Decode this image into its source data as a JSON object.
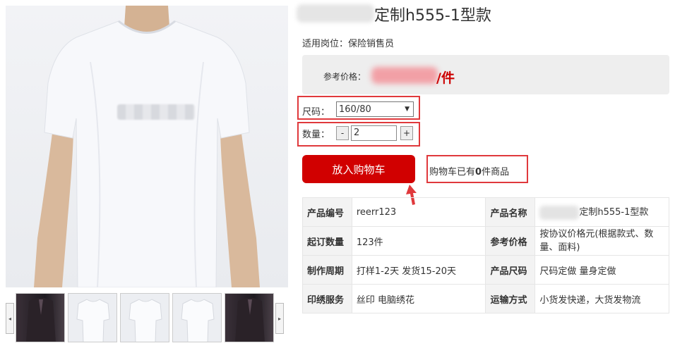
{
  "product": {
    "title": "定制h555-1型款",
    "suitable_label": "适用岗位：保险销售员",
    "price_label": "参考价格：",
    "price_unit": "/件"
  },
  "options": {
    "size_label": "尺码：",
    "size_value": "160/80",
    "qty_label": "数量：",
    "qty_value": "2",
    "minus": "-",
    "plus": "+"
  },
  "cart": {
    "button_label": "放入购物车",
    "info_prefix": "购物车已有",
    "info_count": "0",
    "info_suffix": "件商品"
  },
  "specs": [
    {
      "k1": "产品编号",
      "v1": "reerr123",
      "k2": "产品名称",
      "v2": "定制h555-1型款"
    },
    {
      "k1": "起订数量",
      "v1": "123件",
      "k2": "参考价格",
      "v2": "按协议价格元(根据款式、数量、面料)"
    },
    {
      "k1": "制作周期",
      "v1": "打样1-2天 发货15-20天",
      "k2": "产品尺码",
      "v2": "尺码定做 量身定做"
    },
    {
      "k1": "印绣服务",
      "v1": "丝印 电脑绣花",
      "k2": "运输方式",
      "v2": "小货发快递，大货发物流"
    }
  ],
  "thumbs": {
    "left_arrow": "◂",
    "right_arrow": "▸",
    "items": [
      "dark-coat",
      "white-tshirt",
      "white-tshirt",
      "white-tshirt",
      "dark-coat"
    ]
  },
  "colors": {
    "accent": "#d10000",
    "highlight": "#e0393c",
    "price": "#cc0000"
  }
}
